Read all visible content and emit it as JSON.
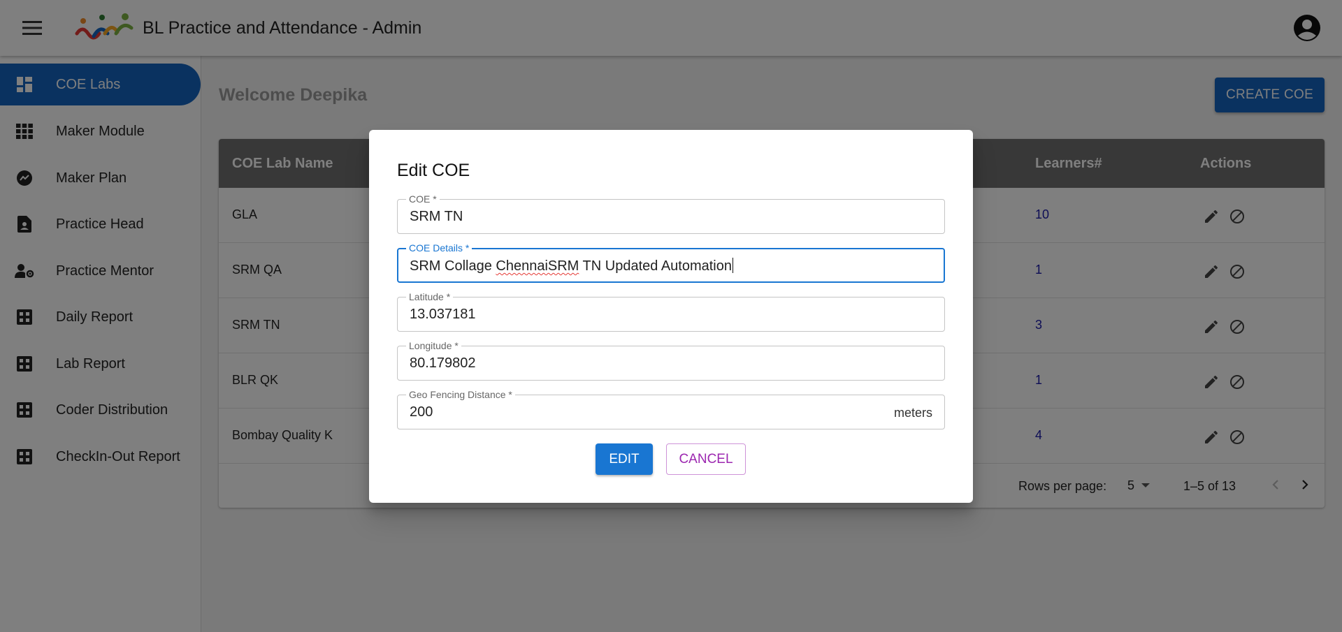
{
  "app": {
    "title": "BL Practice and Attendance - Admin"
  },
  "sidebar": {
    "items": [
      {
        "label": "COE Labs",
        "icon": "dashboard-icon",
        "active": true
      },
      {
        "label": "Maker Module",
        "icon": "grid-icon",
        "active": false
      },
      {
        "label": "Maker Plan",
        "icon": "plan-icon",
        "active": false
      },
      {
        "label": "Practice Head",
        "icon": "contact-page-icon",
        "active": false
      },
      {
        "label": "Practice Mentor",
        "icon": "manage-accounts-icon",
        "active": false
      },
      {
        "label": "Daily Report",
        "icon": "report-grid-icon",
        "active": false
      },
      {
        "label": "Lab Report",
        "icon": "report-grid-icon",
        "active": false
      },
      {
        "label": "Coder Distribution",
        "icon": "report-grid-icon",
        "active": false
      },
      {
        "label": "CheckIn-Out Report",
        "icon": "report-grid-icon",
        "active": false
      }
    ]
  },
  "main": {
    "welcome": "Welcome Deepika",
    "create_label": "CREATE COE",
    "table": {
      "headers": {
        "name": "COE Lab Name",
        "learners": "Learners#",
        "actions": "Actions"
      },
      "rows": [
        {
          "name": "GLA",
          "learners": "10"
        },
        {
          "name": "SRM QA",
          "learners": "1"
        },
        {
          "name": "SRM TN",
          "learners": "3"
        },
        {
          "name": "BLR QK",
          "learners": "1"
        },
        {
          "name": "Bombay Quality K",
          "learners": "4"
        }
      ]
    },
    "pagination": {
      "rows_per_page_label": "Rows per page:",
      "rows_per_page": "5",
      "range": "1–5 of 13"
    }
  },
  "dialog": {
    "title": "Edit COE",
    "fields": {
      "coe": {
        "label": "COE *",
        "value": "SRM TN"
      },
      "details": {
        "label": "COE Details *",
        "value_part1": "SRM Collage ",
        "value_misspelled": "ChennaiSRM",
        "value_part2": " TN Updated Automation"
      },
      "latitude": {
        "label": "Latitude *",
        "value": "13.037181"
      },
      "longitude": {
        "label": "Longitude *",
        "value": "80.179802"
      },
      "geofence": {
        "label": "Geo Fencing Distance *",
        "value": "200",
        "unit": "meters"
      }
    },
    "edit_label": "EDIT",
    "cancel_label": "CANCEL"
  },
  "colors": {
    "primary": "#1565c0",
    "header_bg": "#707070",
    "learners_link": "#1a1aaa",
    "cancel": "#9c27b0"
  }
}
